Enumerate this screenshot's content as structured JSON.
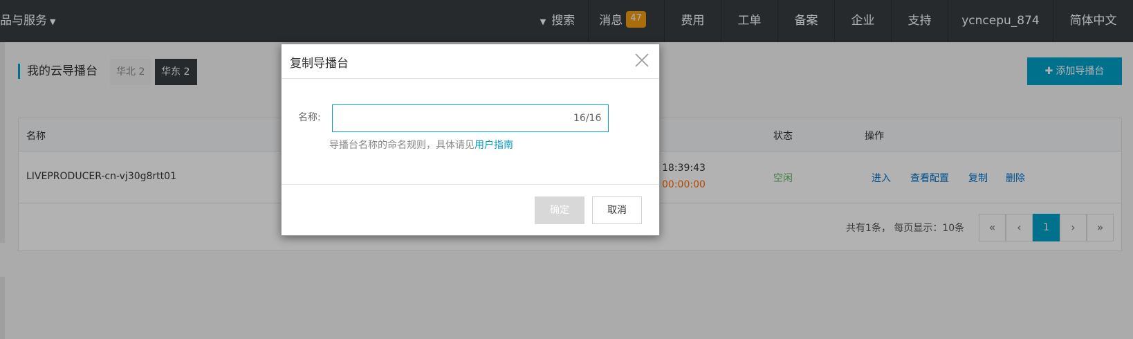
{
  "topbar": {
    "products_label": "品与服务",
    "search_label": "搜索",
    "messages_label": "消息",
    "messages_count": "47",
    "items": [
      "费用",
      "工单",
      "备案",
      "企业",
      "支持"
    ],
    "username": "ycncepu_874",
    "language": "简体中文"
  },
  "page": {
    "title": "我的云导播台",
    "regions": [
      "华北 2",
      "华东 2"
    ],
    "add_button": "添加导播台"
  },
  "table": {
    "columns": [
      "名称",
      "状态",
      "操作"
    ],
    "row": {
      "name": "LIVEPRODUCER-cn-vj30g8rtt01",
      "time": "18:39:43",
      "duration": "00:00:00",
      "status": "空闲",
      "actions": [
        "进入",
        "查看配置",
        "复制",
        "删除"
      ]
    },
    "pager": {
      "info": "共有1条， 每页显示：10条",
      "first": "«",
      "prev": "‹",
      "current": "1",
      "next": "›",
      "last": "»"
    }
  },
  "modal": {
    "title": "复制导播台",
    "field_label": "名称:",
    "field_value": "",
    "char_count": "16/16",
    "hint_text": "导播台名称的命名规则，具体请见",
    "hint_link": "用户指南",
    "confirm_label": "确定",
    "cancel_label": "取消"
  },
  "colors": {
    "topbar": "#373d41",
    "accent": "#00a2ca",
    "status_idle": "#5cb85c",
    "duration": "#ff6a00",
    "link": "#0073cc"
  }
}
